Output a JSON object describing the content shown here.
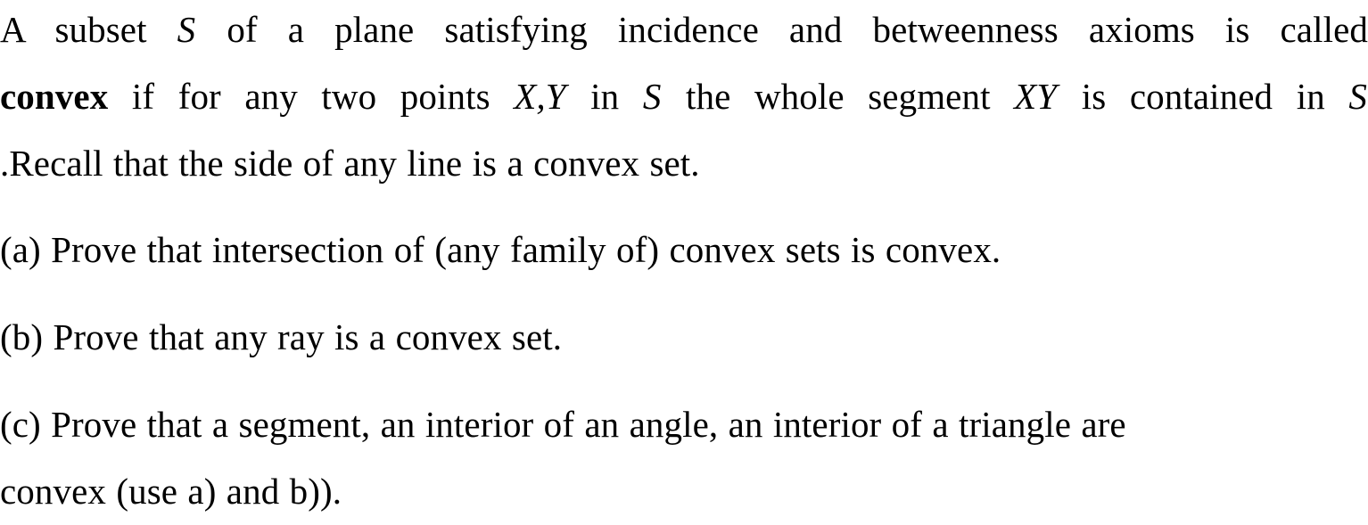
{
  "document": {
    "type": "math-exercise",
    "background_color": "#ffffff",
    "text_color": "#000000",
    "intro": {
      "line1_pre": "A subset ",
      "line1_math_S": "S",
      "line1_post": " of a plane satisfying incidence and betweenness axioms is called",
      "line2_bold": "convex",
      "line2_a": " if for any two points ",
      "line2_math_XY": "X,Y",
      "line2_b": " in ",
      "line2_math_S2": "S",
      "line2_c": " the whole segment ",
      "line2_math_XY2": "XY",
      "line2_d": " is contained in ",
      "line2_math_S3": "S",
      "line3": ".Recall that the side of any line is a convex set.",
      "full_text": "A subset S of a plane satisfying incidence and betweenness axioms is called convex if for any two points X,Y in S the whole segment XY is contained in S .Recall that the side of any line is a convex set."
    },
    "items": [
      {
        "label": "(a)",
        "text": "(a) Prove that intersection of (any family of) convex sets is convex."
      },
      {
        "label": "(b)",
        "text": "(b) Prove that any ray is a convex set."
      },
      {
        "label": "(c)",
        "line1": "(c) Prove that a segment, an interior of an angle, an interior of a triangle are",
        "line2": "convex (use a) and b))."
      }
    ]
  }
}
